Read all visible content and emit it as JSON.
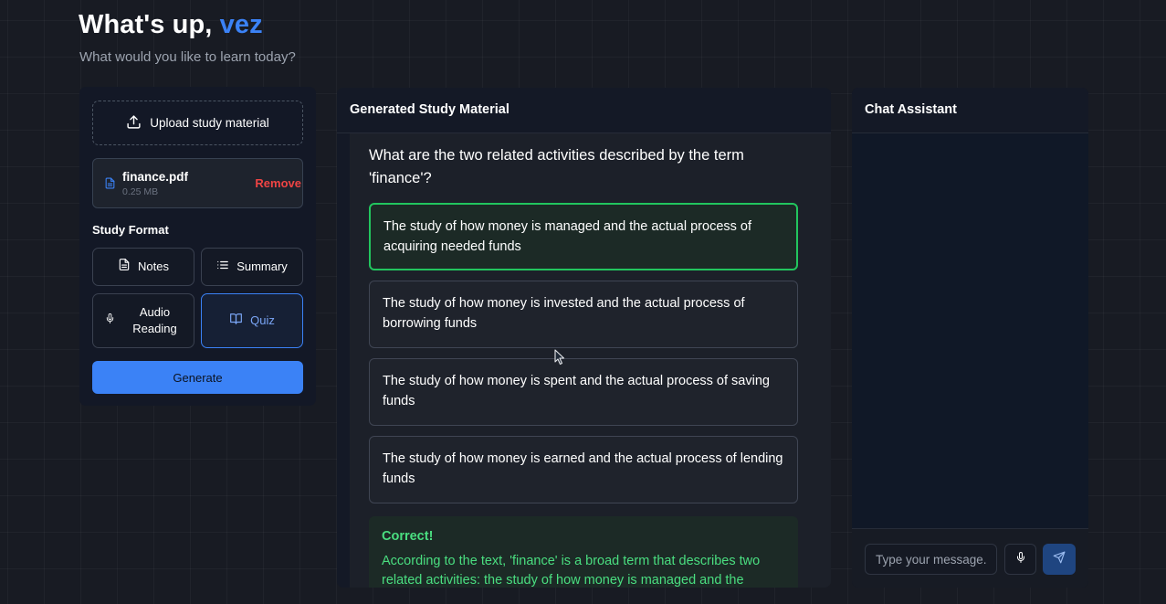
{
  "header": {
    "greeting": "What's up, ",
    "username": "vez",
    "subtitle": "What would you like to learn today?"
  },
  "sidebar": {
    "upload_label": "Upload study material",
    "file": {
      "name": "finance.pdf",
      "size": "0.25 MB",
      "remove_label": "Remove"
    },
    "format_label": "Study Format",
    "formats": [
      {
        "label": "Notes",
        "icon": "document-icon",
        "selected": false
      },
      {
        "label": "Summary",
        "icon": "list-icon",
        "selected": false
      },
      {
        "label": "Audio Reading",
        "icon": "mic-icon",
        "selected": false
      },
      {
        "label": "Quiz",
        "icon": "book-open-icon",
        "selected": true
      }
    ],
    "generate_label": "Generate"
  },
  "study": {
    "title": "Generated Study Material",
    "question": "What are the two related activities described by the term 'finance'?",
    "options": [
      {
        "text": "The study of how money is managed and the actual process of acquiring needed funds",
        "correct": true
      },
      {
        "text": "The study of how money is invested and the actual process of borrowing funds",
        "correct": false
      },
      {
        "text": "The study of how money is spent and the actual process of saving funds",
        "correct": false
      },
      {
        "text": "The study of how money is earned and the actual process of lending funds",
        "correct": false
      }
    ],
    "feedback": {
      "title": "Correct!",
      "text": "According to the text, 'finance' is a broad term that describes two related activities: the study of how money is managed and the"
    }
  },
  "chat": {
    "title": "Chat Assistant",
    "placeholder": "Type your message..",
    "mic_icon": "mic-icon",
    "send_icon": "send-icon"
  },
  "colors": {
    "accent": "#3b82f6",
    "success": "#22c55e",
    "danger": "#ef4444"
  }
}
